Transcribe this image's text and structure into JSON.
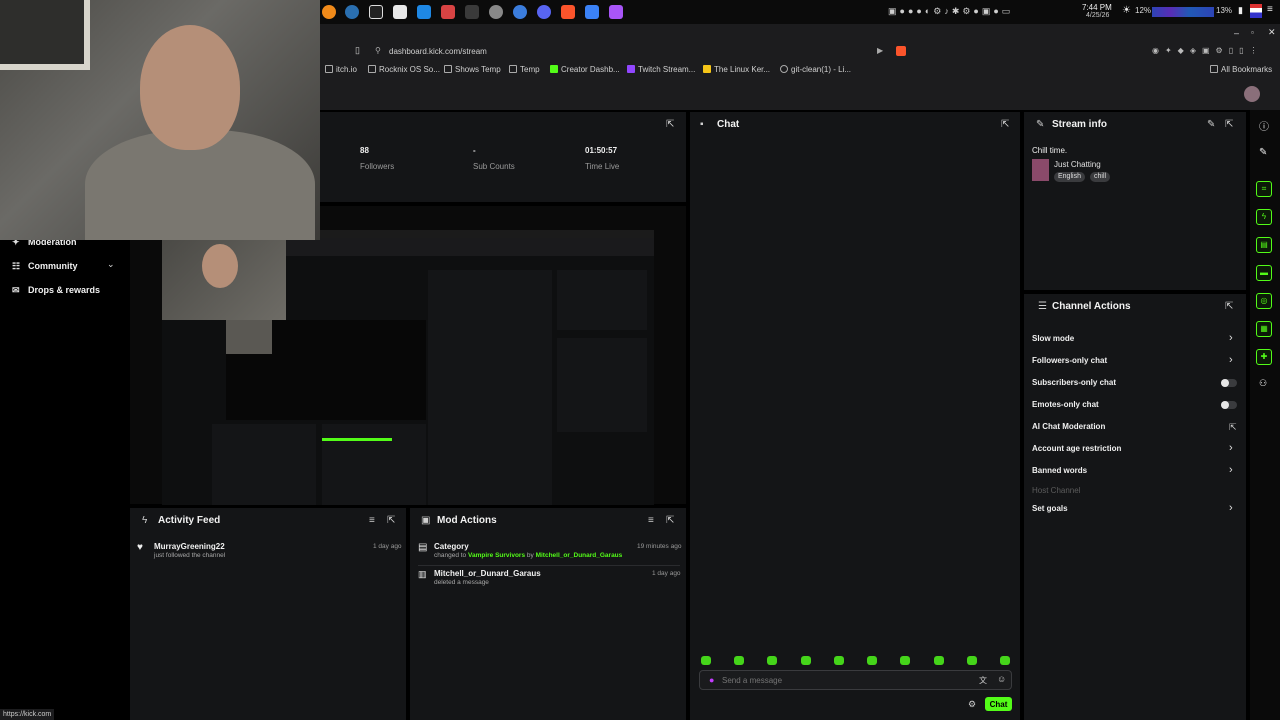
{
  "taskbar": {
    "clock_time": "7:44 PM",
    "clock_date": "4/25/26",
    "battery_left": "12%",
    "battery_right": "13%"
  },
  "browser": {
    "url": "dashboard.kick.com/stream",
    "bookmarks": [
      "itch.io",
      "Rocknix OS So...",
      "Shows Temp",
      "Temp",
      "Creator Dashb...",
      "Twitch Stream...",
      "The Linux Ker...",
      "git-clean(1) - Li..."
    ],
    "all_bookmarks": "All Bookmarks"
  },
  "sidebar": {
    "items": [
      {
        "label": "Moderation",
        "icon": "shield-icon"
      },
      {
        "label": "Community",
        "icon": "people-icon"
      },
      {
        "label": "Drops & rewards",
        "icon": "gift-icon"
      }
    ]
  },
  "stats": [
    {
      "value": "88",
      "label": "Followers"
    },
    {
      "value": "-",
      "label": "Sub Counts"
    },
    {
      "value": "01:50:57",
      "label": "Time Live"
    }
  ],
  "chat": {
    "title": "Chat",
    "placeholder": "Send a message",
    "send_label": "Chat"
  },
  "stream_info": {
    "title": "Stream info",
    "stream_title": "Chill time.",
    "category": "Just Chatting",
    "tags": [
      "English",
      "chill"
    ]
  },
  "channel_actions": {
    "title": "Channel Actions",
    "items": [
      {
        "label": "Slow mode",
        "control": "chevron"
      },
      {
        "label": "Followers-only chat",
        "control": "chevron"
      },
      {
        "label": "Subscribers-only chat",
        "control": "toggle"
      },
      {
        "label": "Emotes-only chat",
        "control": "toggle"
      },
      {
        "label": "AI Chat Moderation",
        "control": "external"
      },
      {
        "label": "Account age restriction",
        "control": "chevron"
      },
      {
        "label": "Banned words",
        "control": "chevron"
      },
      {
        "label": "Host Channel",
        "control": "none"
      },
      {
        "label": "Set goals",
        "control": "chevron"
      }
    ]
  },
  "activity_feed": {
    "title": "Activity Feed",
    "entries": [
      {
        "name": "MurrayGreening22",
        "detail": "just followed the channel",
        "time": "1 day ago"
      }
    ]
  },
  "mod_actions": {
    "title": "Mod Actions",
    "entries": [
      {
        "title": "Category",
        "pre": "changed to",
        "game": "Vampire Survivors",
        "mid": "by",
        "user": "Mitchell_or_Dunard_Garaus",
        "time": "19 minutes ago"
      },
      {
        "title": "Mitchell_or_Dunard_Garaus",
        "detail": "deleted a message",
        "time": "1 day ago"
      }
    ]
  },
  "status_bar": {
    "url": "https://kick.com"
  },
  "colors": {
    "accent": "#53fc18",
    "panel": "#141517",
    "background": "#000000"
  }
}
